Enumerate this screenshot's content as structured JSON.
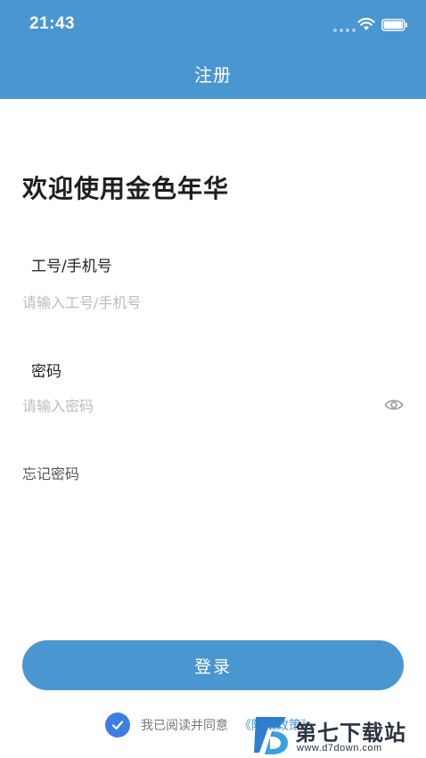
{
  "status_bar": {
    "time": "21:43"
  },
  "nav": {
    "title": "注册"
  },
  "welcome": "欢迎使用金色年华",
  "account": {
    "label": "工号/手机号",
    "placeholder": "请输入工号/手机号",
    "value": ""
  },
  "password": {
    "label": "密码",
    "placeholder": "请输入密码",
    "value": ""
  },
  "forgot_label": "忘记密码",
  "login_label": "登录",
  "agreement": {
    "checked": true,
    "text": "我已阅读并同意",
    "link": "《隐私政策》"
  },
  "watermark": {
    "text": "第七下载站",
    "url": "www.d7down.com"
  },
  "colors": {
    "primary": "#4a96d0",
    "check": "#3d7fe0"
  }
}
